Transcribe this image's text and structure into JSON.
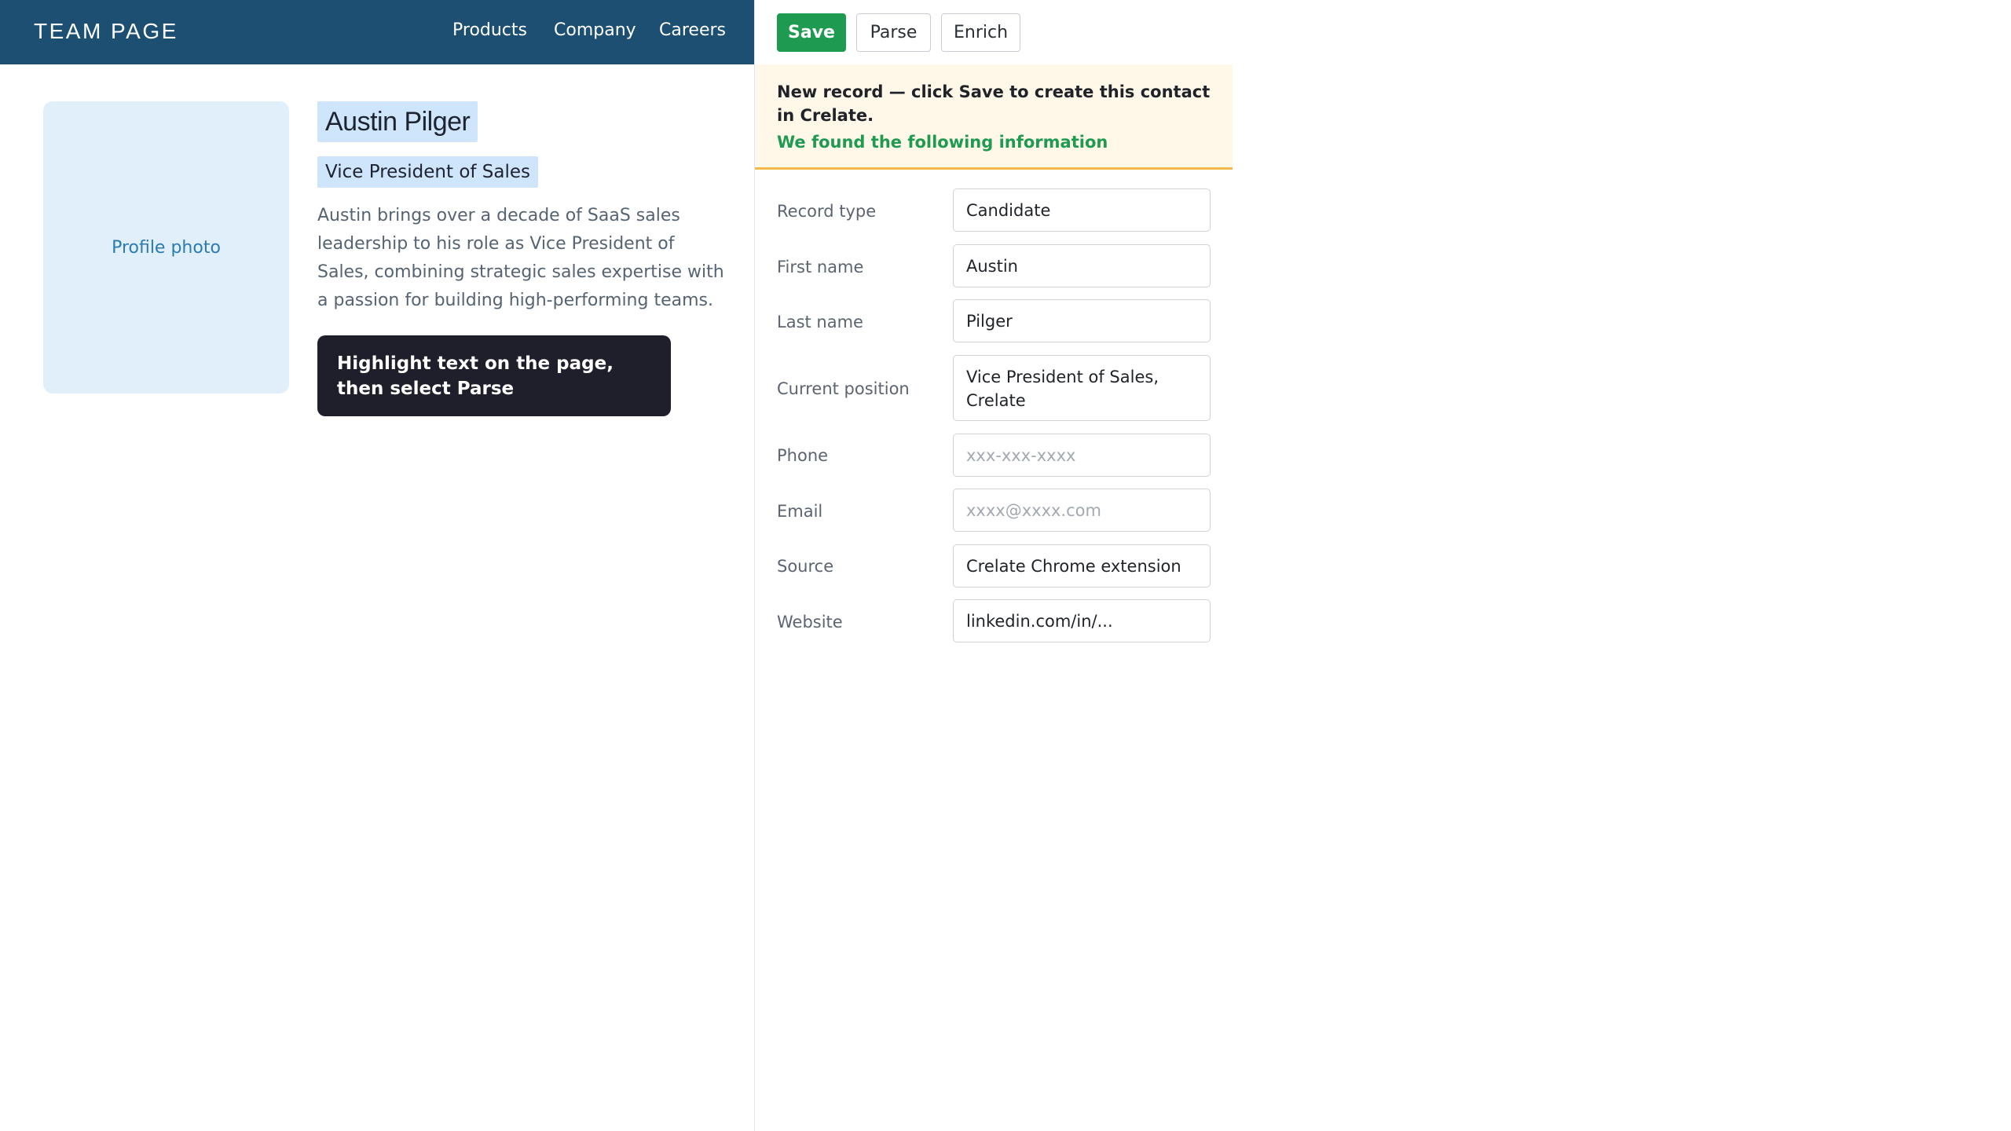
{
  "site": {
    "brand": "TEAM PAGE",
    "nav": [
      "Products",
      "Company",
      "Careers"
    ],
    "photo_label": "Profile photo",
    "person": {
      "name": "Austin Pilger",
      "title": "Vice President of Sales",
      "bio": "Austin brings over a decade of SaaS sales leadership to his role as Vice President of Sales, combining strategic sales expertise with a passion for building high-performing teams."
    },
    "tooltip": "Highlight text on the page, then select Parse"
  },
  "panel": {
    "toolbar": {
      "save": "Save",
      "parse": "Parse",
      "enrich": "Enrich"
    },
    "notice": {
      "text": "New record — click Save to create this contact in Crelate.",
      "found": "We found the following information"
    },
    "fields": [
      {
        "label": "Record type",
        "value": "Candidate",
        "placeholder": ""
      },
      {
        "label": "First name",
        "value": "Austin",
        "placeholder": ""
      },
      {
        "label": "Last name",
        "value": "Pilger",
        "placeholder": ""
      },
      {
        "label": "Current position",
        "value": "Vice President of Sales, Crelate",
        "placeholder": ""
      },
      {
        "label": "Phone",
        "value": "",
        "placeholder": "xxx-xxx-xxxx"
      },
      {
        "label": "Email",
        "value": "",
        "placeholder": "xxxx@xxxx.com"
      },
      {
        "label": "Source",
        "value": "Crelate Chrome extension",
        "placeholder": ""
      },
      {
        "label": "Website",
        "value": "linkedin.com/in/...",
        "placeholder": ""
      }
    ],
    "colors": {
      "save": "#1e9b50",
      "notice_bg": "#fff8e9",
      "notice_border": "#f3b94a",
      "header": "#1d4f73"
    }
  }
}
